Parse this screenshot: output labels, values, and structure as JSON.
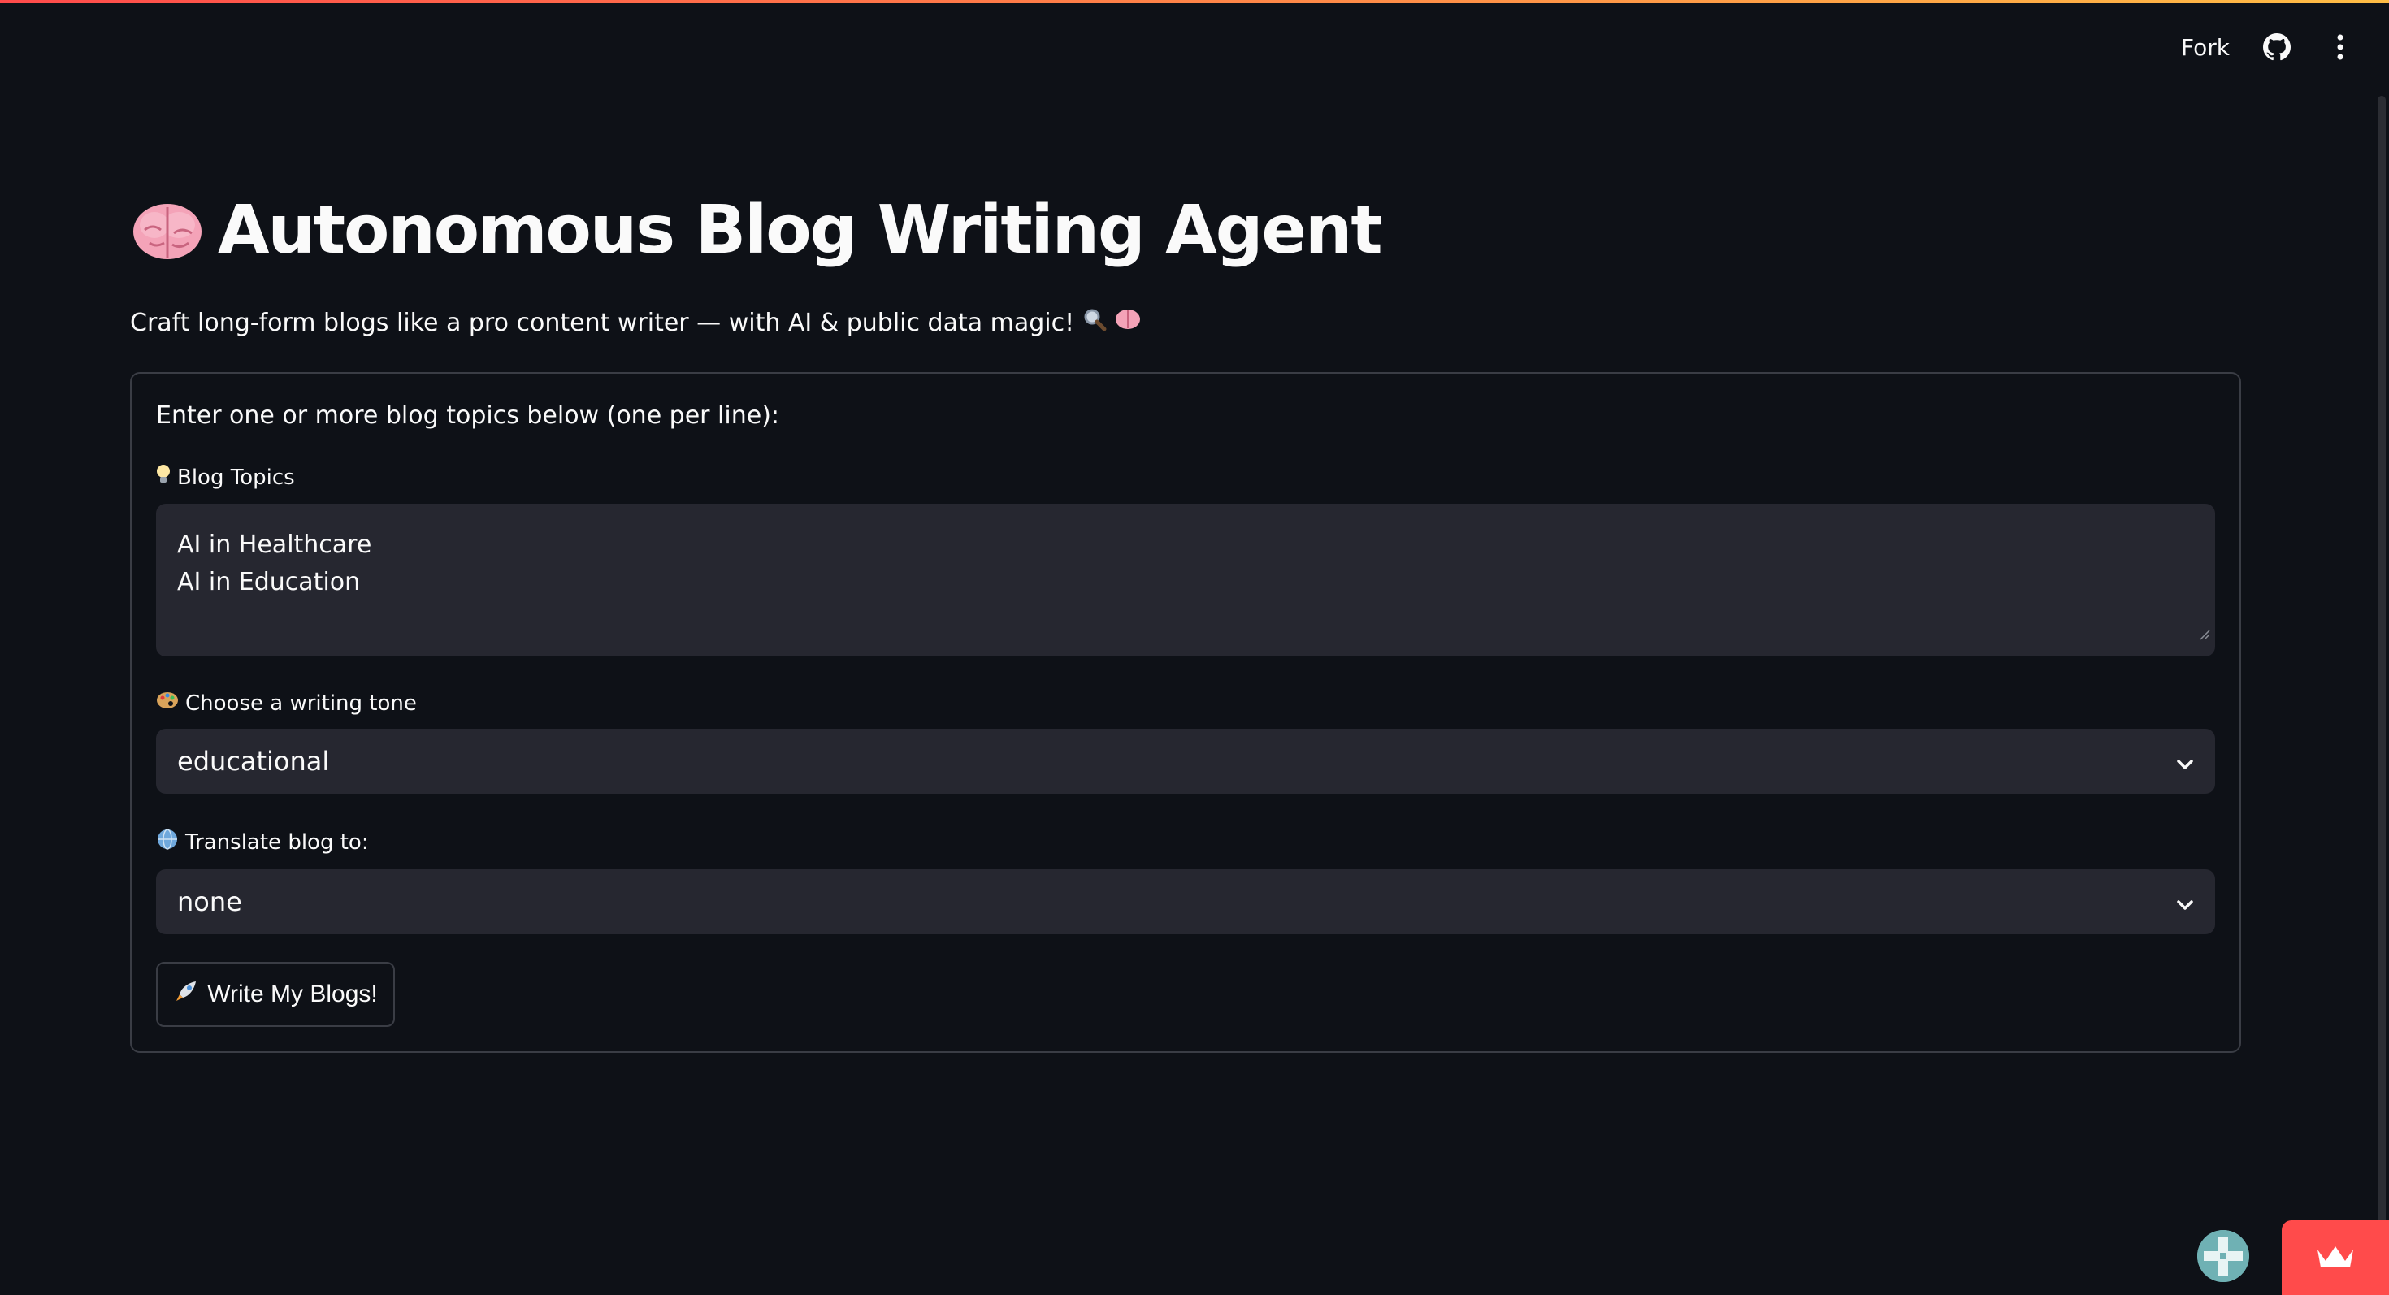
{
  "header": {
    "fork_label": "Fork",
    "github_icon": "github-icon",
    "menu_icon": "vertical-dots-icon"
  },
  "main": {
    "title": "Autonomous Blog Writing Agent",
    "title_icon": "brain-emoji-icon",
    "subtitle": "Craft long-form blogs like a pro content writer — with AI & public data magic!",
    "subtitle_icons": [
      "magnifier-emoji-icon",
      "brain-emoji-icon"
    ]
  },
  "form": {
    "intro": "Enter one or more blog topics below (one per line):",
    "topics": {
      "label": "Blog Topics",
      "label_icon": "lightbulb-emoji-icon",
      "value_line1": "AI in Healthcare",
      "value_line2": "AI in Education"
    },
    "tone": {
      "label": "Choose a writing tone",
      "label_icon": "palette-emoji-icon",
      "selected": "educational"
    },
    "translate": {
      "label": "Translate blog to:",
      "label_icon": "globe-emoji-icon",
      "selected": "none"
    },
    "submit_label": "Write My Blogs!",
    "submit_icon": "rocket-emoji-icon"
  },
  "footer": {
    "avatar_icon": "user-avatar-icon",
    "badge_icon": "crown-icon"
  },
  "colors": {
    "background": "#0e1117",
    "surface": "#262730",
    "border": "#3a3d45",
    "text": "#fafafa",
    "accent": "#ff4b4b"
  }
}
